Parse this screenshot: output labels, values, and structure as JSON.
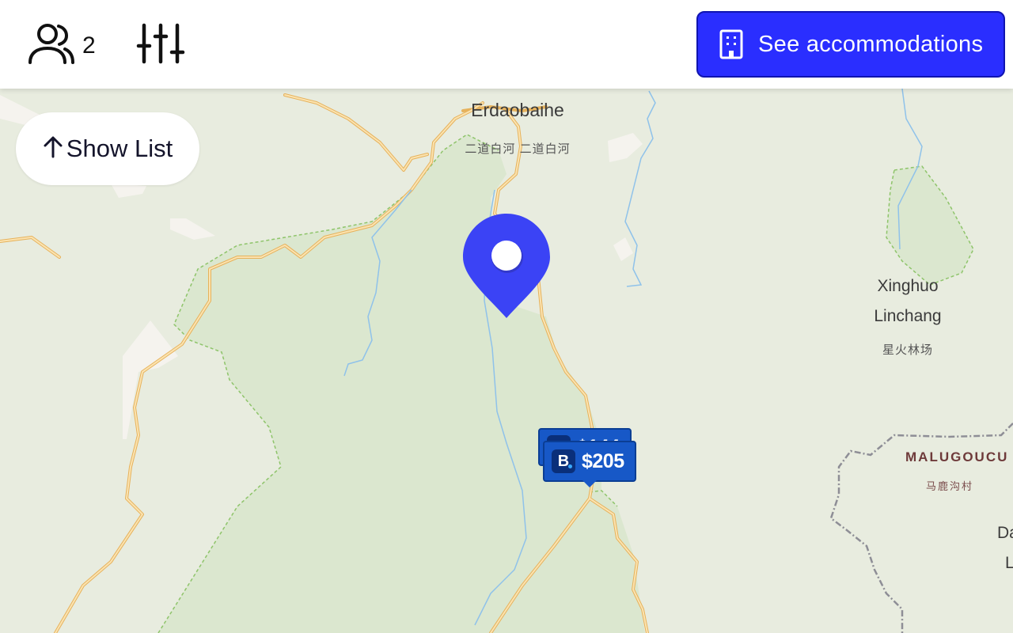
{
  "header": {
    "guests_icon": "users-icon",
    "guests_count": "2",
    "filters_icon": "sliders-icon",
    "cta_icon": "building-icon",
    "cta_label": "See accommodations",
    "cta_color": "#2a2eff"
  },
  "show_list": {
    "icon": "arrow-up-icon",
    "label": "Show List"
  },
  "map": {
    "labels": {
      "erdaobaihe": "Erdaobaihe",
      "erdaobaihe_local": "二道白河 二道白河",
      "xinghuo_line1": "Xinghuo",
      "xinghuo_line2": "Linchang",
      "xinghuo_local": "星火林场",
      "malugoucun": "MALUGOUCU",
      "malugoucun_local": "马鹿沟村",
      "edge_da": "Da",
      "edge_l": "L"
    },
    "location_pin_color": "#3b43f5",
    "price_tags": [
      {
        "brand_icon": "booking-b-icon",
        "brand_letter": "B",
        "price": "$144"
      },
      {
        "brand_icon": "booking-b-icon",
        "brand_letter": "B",
        "price": "$205"
      }
    ],
    "colors": {
      "land": "#e8ecdf",
      "park": "#dbe7cf",
      "road": "#f2c77a",
      "water": "#8fc2ea",
      "border": "#8e8e96"
    }
  }
}
